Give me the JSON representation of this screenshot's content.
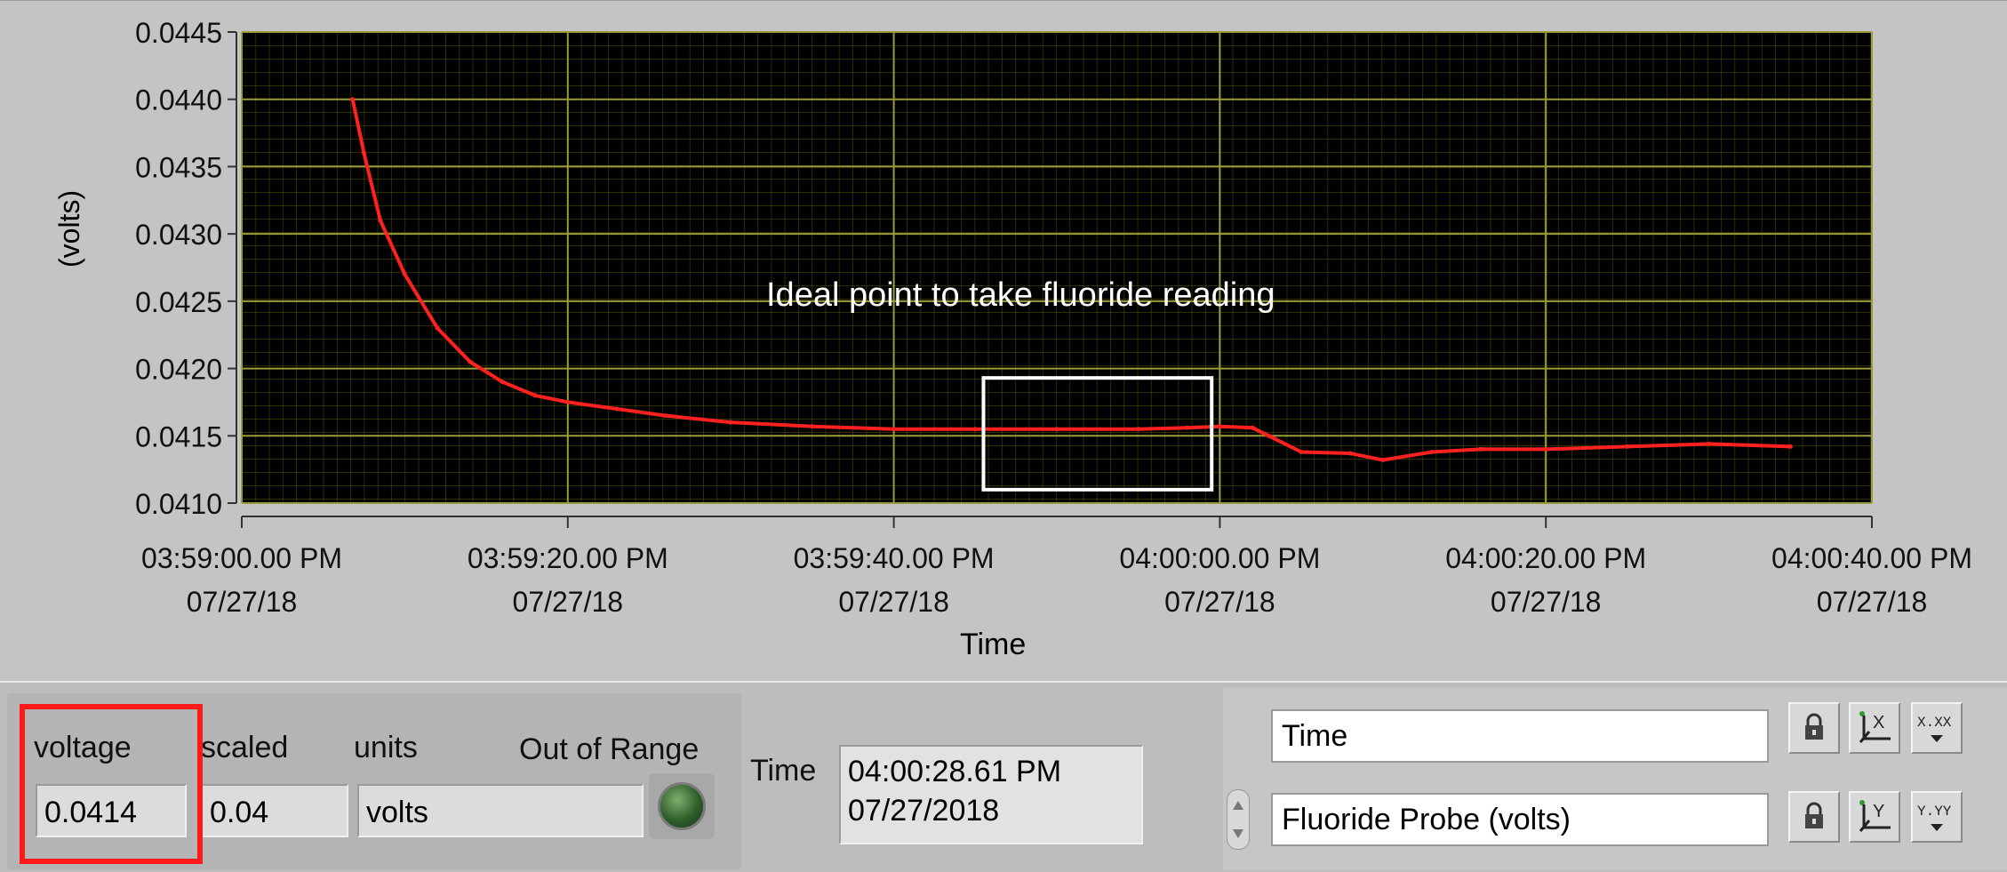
{
  "chart_data": {
    "type": "line",
    "annotation": "Ideal point to take fluoride reading",
    "xlabel": "Time",
    "ylabel": "(volts)",
    "ylim": [
      0.041,
      0.0445
    ],
    "yticks": [
      "0.0445",
      "0.0440",
      "0.0435",
      "0.0430",
      "0.0425",
      "0.0420",
      "0.0415",
      "0.0410"
    ],
    "xticks": [
      {
        "time": "03:59:00.00 PM",
        "date": "07/27/18"
      },
      {
        "time": "03:59:20.00 PM",
        "date": "07/27/18"
      },
      {
        "time": "03:59:40.00 PM",
        "date": "07/27/18"
      },
      {
        "time": "04:00:00.00 PM",
        "date": "07/27/18"
      },
      {
        "time": "04:00:20.00 PM",
        "date": "07/27/18"
      },
      {
        "time": "04:00:40.00 PM",
        "date": "07/27/18"
      }
    ],
    "xlim_seconds": [
      0,
      100
    ],
    "series": [
      {
        "color": "#ff2020",
        "x_seconds": [
          6.8,
          7.5,
          8.5,
          10,
          12,
          14,
          16,
          18,
          20,
          23,
          26,
          30,
          35,
          40,
          45,
          50,
          55,
          58,
          60,
          62,
          63,
          65,
          68,
          70,
          73,
          76,
          80,
          85,
          90,
          95
        ],
        "values": [
          0.044,
          0.0436,
          0.0431,
          0.0427,
          0.0423,
          0.04205,
          0.0419,
          0.0418,
          0.04175,
          0.0417,
          0.04165,
          0.0416,
          0.04157,
          0.04155,
          0.04155,
          0.04155,
          0.04155,
          0.04156,
          0.04157,
          0.04156,
          0.0415,
          0.04138,
          0.04137,
          0.04132,
          0.04138,
          0.0414,
          0.0414,
          0.04142,
          0.04144,
          0.04142
        ]
      }
    ],
    "highlight_box_x_seconds": [
      45.5,
      59.5
    ],
    "highlight_box_y": [
      0.0411,
      0.04193
    ]
  },
  "controls": {
    "voltage_label": "voltage",
    "voltage_value": "0.0414",
    "scaled_label": "scaled",
    "scaled_value": "0.04",
    "units_label": "units",
    "units_value": "volts",
    "out_of_range_label": "Out of Range",
    "time_label": "Time",
    "time_value_line1": "04:00:28.61 PM",
    "time_value_line2": "07/27/2018"
  },
  "legend": {
    "x_axis_name": "Time",
    "y_axis_name": "Fluoride Probe (volts)",
    "x_format_label": "X.XX",
    "y_format_label": "Y.YY",
    "x_scale_label": "X",
    "y_scale_label": "Y"
  },
  "colors": {
    "plot_background": "#000000",
    "grid": "#808000",
    "trace": "#ff2020",
    "highlight_box": "#ffffff",
    "voltage_highlight": "#ff1a1a",
    "led_off": "#2e5f2a"
  }
}
